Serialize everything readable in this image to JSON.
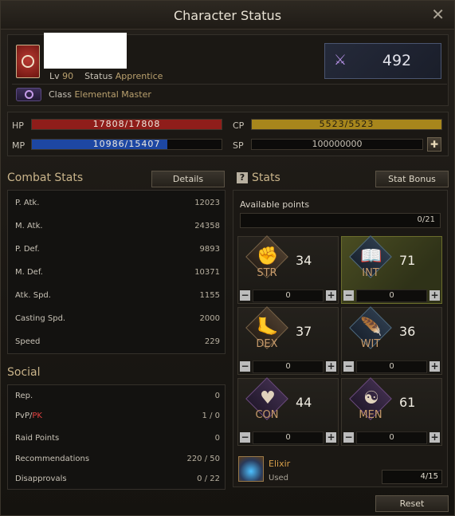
{
  "window": {
    "title": "Character Status",
    "close_icon": "close-icon"
  },
  "profile": {
    "level_label": "Lv",
    "level": "90",
    "status_label": "Status",
    "status": "Apprentice",
    "class_label": "Class",
    "class": "Elemental Master",
    "badge_value": "492"
  },
  "vitals": {
    "hp": {
      "label": "HP",
      "text": "17808/17808",
      "fraction": 1.0,
      "color": "#8f1d1a"
    },
    "mp": {
      "label": "MP",
      "text": "10986/15407",
      "fraction": 0.713,
      "color": "#1d47a3"
    },
    "cp": {
      "label": "CP",
      "text": "5523/5523",
      "fraction": 1.0,
      "color": "#a7861c"
    },
    "sp": {
      "label": "SP",
      "text": "100000000"
    }
  },
  "combat": {
    "title": "Combat Stats",
    "details_label": "Details",
    "rows": [
      {
        "k": "P. Atk.",
        "v": "12023"
      },
      {
        "k": "M. Atk.",
        "v": "24358"
      },
      {
        "k": "P. Def.",
        "v": "9893"
      },
      {
        "k": "M. Def.",
        "v": "10371"
      },
      {
        "k": "Atk. Spd.",
        "v": "1155"
      },
      {
        "k": "Casting Spd.",
        "v": "2000"
      },
      {
        "k": "Speed",
        "v": "229"
      }
    ]
  },
  "social": {
    "title": "Social",
    "rows": [
      {
        "k": "Rep.",
        "v": "0"
      },
      {
        "k": "PvP/",
        "k2": "PK",
        "v": "1 / 0"
      },
      {
        "k": "Raid Points",
        "v": "0"
      },
      {
        "k": "Recommendations",
        "v": "220 / 50"
      },
      {
        "k": "Disapprovals",
        "v": "0 / 22"
      }
    ]
  },
  "stats": {
    "help_icon": "?",
    "title": "Stats",
    "bonus_label": "Stat Bonus",
    "available_label": "Available points",
    "available_value": "0/21",
    "items": [
      {
        "abbr": "STR",
        "value": "34",
        "alloc": "0"
      },
      {
        "abbr": "INT",
        "value": "71",
        "alloc": "0"
      },
      {
        "abbr": "DEX",
        "value": "37",
        "alloc": "0"
      },
      {
        "abbr": "WIT",
        "value": "36",
        "alloc": "0"
      },
      {
        "abbr": "CON",
        "value": "44",
        "alloc": "0"
      },
      {
        "abbr": "MEN",
        "value": "61",
        "alloc": "0"
      }
    ],
    "minus": "−",
    "plus": "+"
  },
  "elixir": {
    "name": "Elixir",
    "used_label": "Used",
    "used_value": "4/15"
  },
  "reset_label": "Reset"
}
